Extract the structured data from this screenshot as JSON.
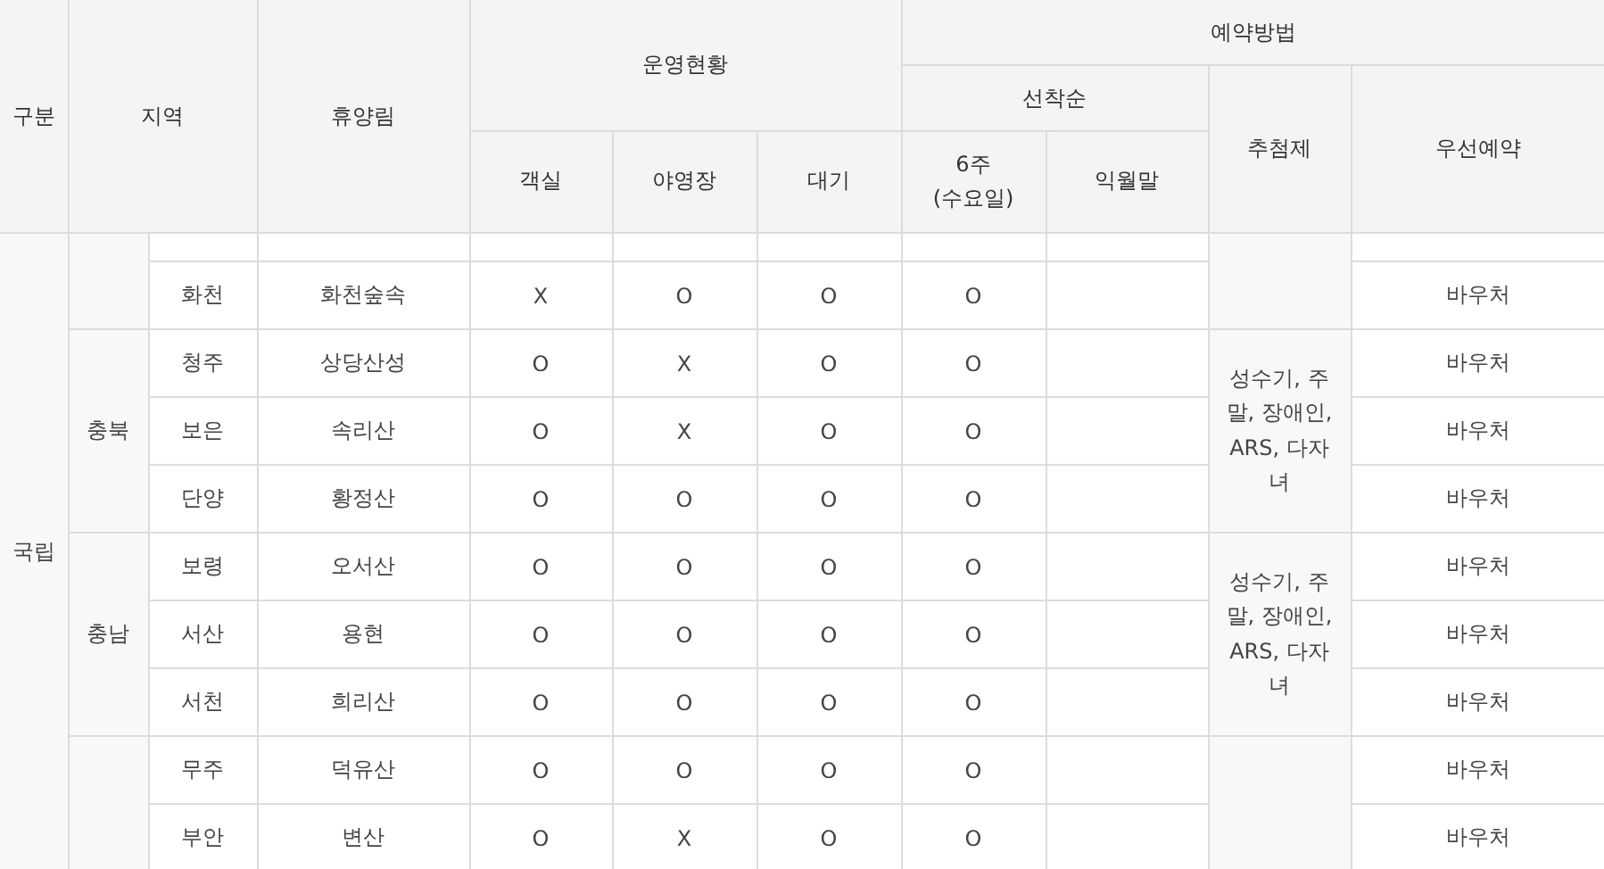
{
  "table": {
    "header": {
      "category": "구분",
      "region": "지역",
      "forest": "휴양림",
      "operation": {
        "title": "운영현황",
        "columns": [
          "객실",
          "야영장",
          "대기"
        ]
      },
      "reservation": {
        "title": "예약방법",
        "first_come": {
          "title": "선착순",
          "columns": [
            "6주\n(수요일)",
            "익월말"
          ]
        },
        "lottery": "추첨제",
        "priority": "우선예약"
      }
    },
    "category": "국립",
    "groups": [
      {
        "rows": [
          {
            "city": "화천",
            "forest": "화천숲속",
            "room": "X",
            "camp": "O",
            "wait": "O",
            "week6": "O",
            "priority": "바우처"
          }
        ]
      },
      {
        "province": "충북",
        "lottery": "성수기, 주말, 장애인, ARS, 다자녀",
        "rows": [
          {
            "city": "청주",
            "forest": "상당산성",
            "room": "O",
            "camp": "X",
            "wait": "O",
            "week6": "O",
            "priority": "바우처"
          },
          {
            "city": "보은",
            "forest": "속리산",
            "room": "O",
            "camp": "X",
            "wait": "O",
            "week6": "O",
            "priority": "바우처"
          },
          {
            "city": "단양",
            "forest": "황정산",
            "room": "O",
            "camp": "O",
            "wait": "O",
            "week6": "O",
            "priority": "바우처"
          }
        ]
      },
      {
        "province": "충남",
        "lottery": "성수기, 주말, 장애인, ARS, 다자녀",
        "rows": [
          {
            "city": "보령",
            "forest": "오서산",
            "room": "O",
            "camp": "O",
            "wait": "O",
            "week6": "O",
            "priority": "바우처"
          },
          {
            "city": "서산",
            "forest": "용현",
            "room": "O",
            "camp": "O",
            "wait": "O",
            "week6": "O",
            "priority": "바우처"
          },
          {
            "city": "서천",
            "forest": "희리산",
            "room": "O",
            "camp": "O",
            "wait": "O",
            "week6": "O",
            "priority": "바우처"
          }
        ]
      },
      {
        "rows": [
          {
            "city": "무주",
            "forest": "덕유산",
            "room": "O",
            "camp": "O",
            "wait": "O",
            "week6": "O",
            "priority": "바우처"
          },
          {
            "city": "부안",
            "forest": "변산",
            "room": "O",
            "camp": "X",
            "wait": "O",
            "week6": "O",
            "priority": "바우처"
          }
        ]
      }
    ]
  }
}
